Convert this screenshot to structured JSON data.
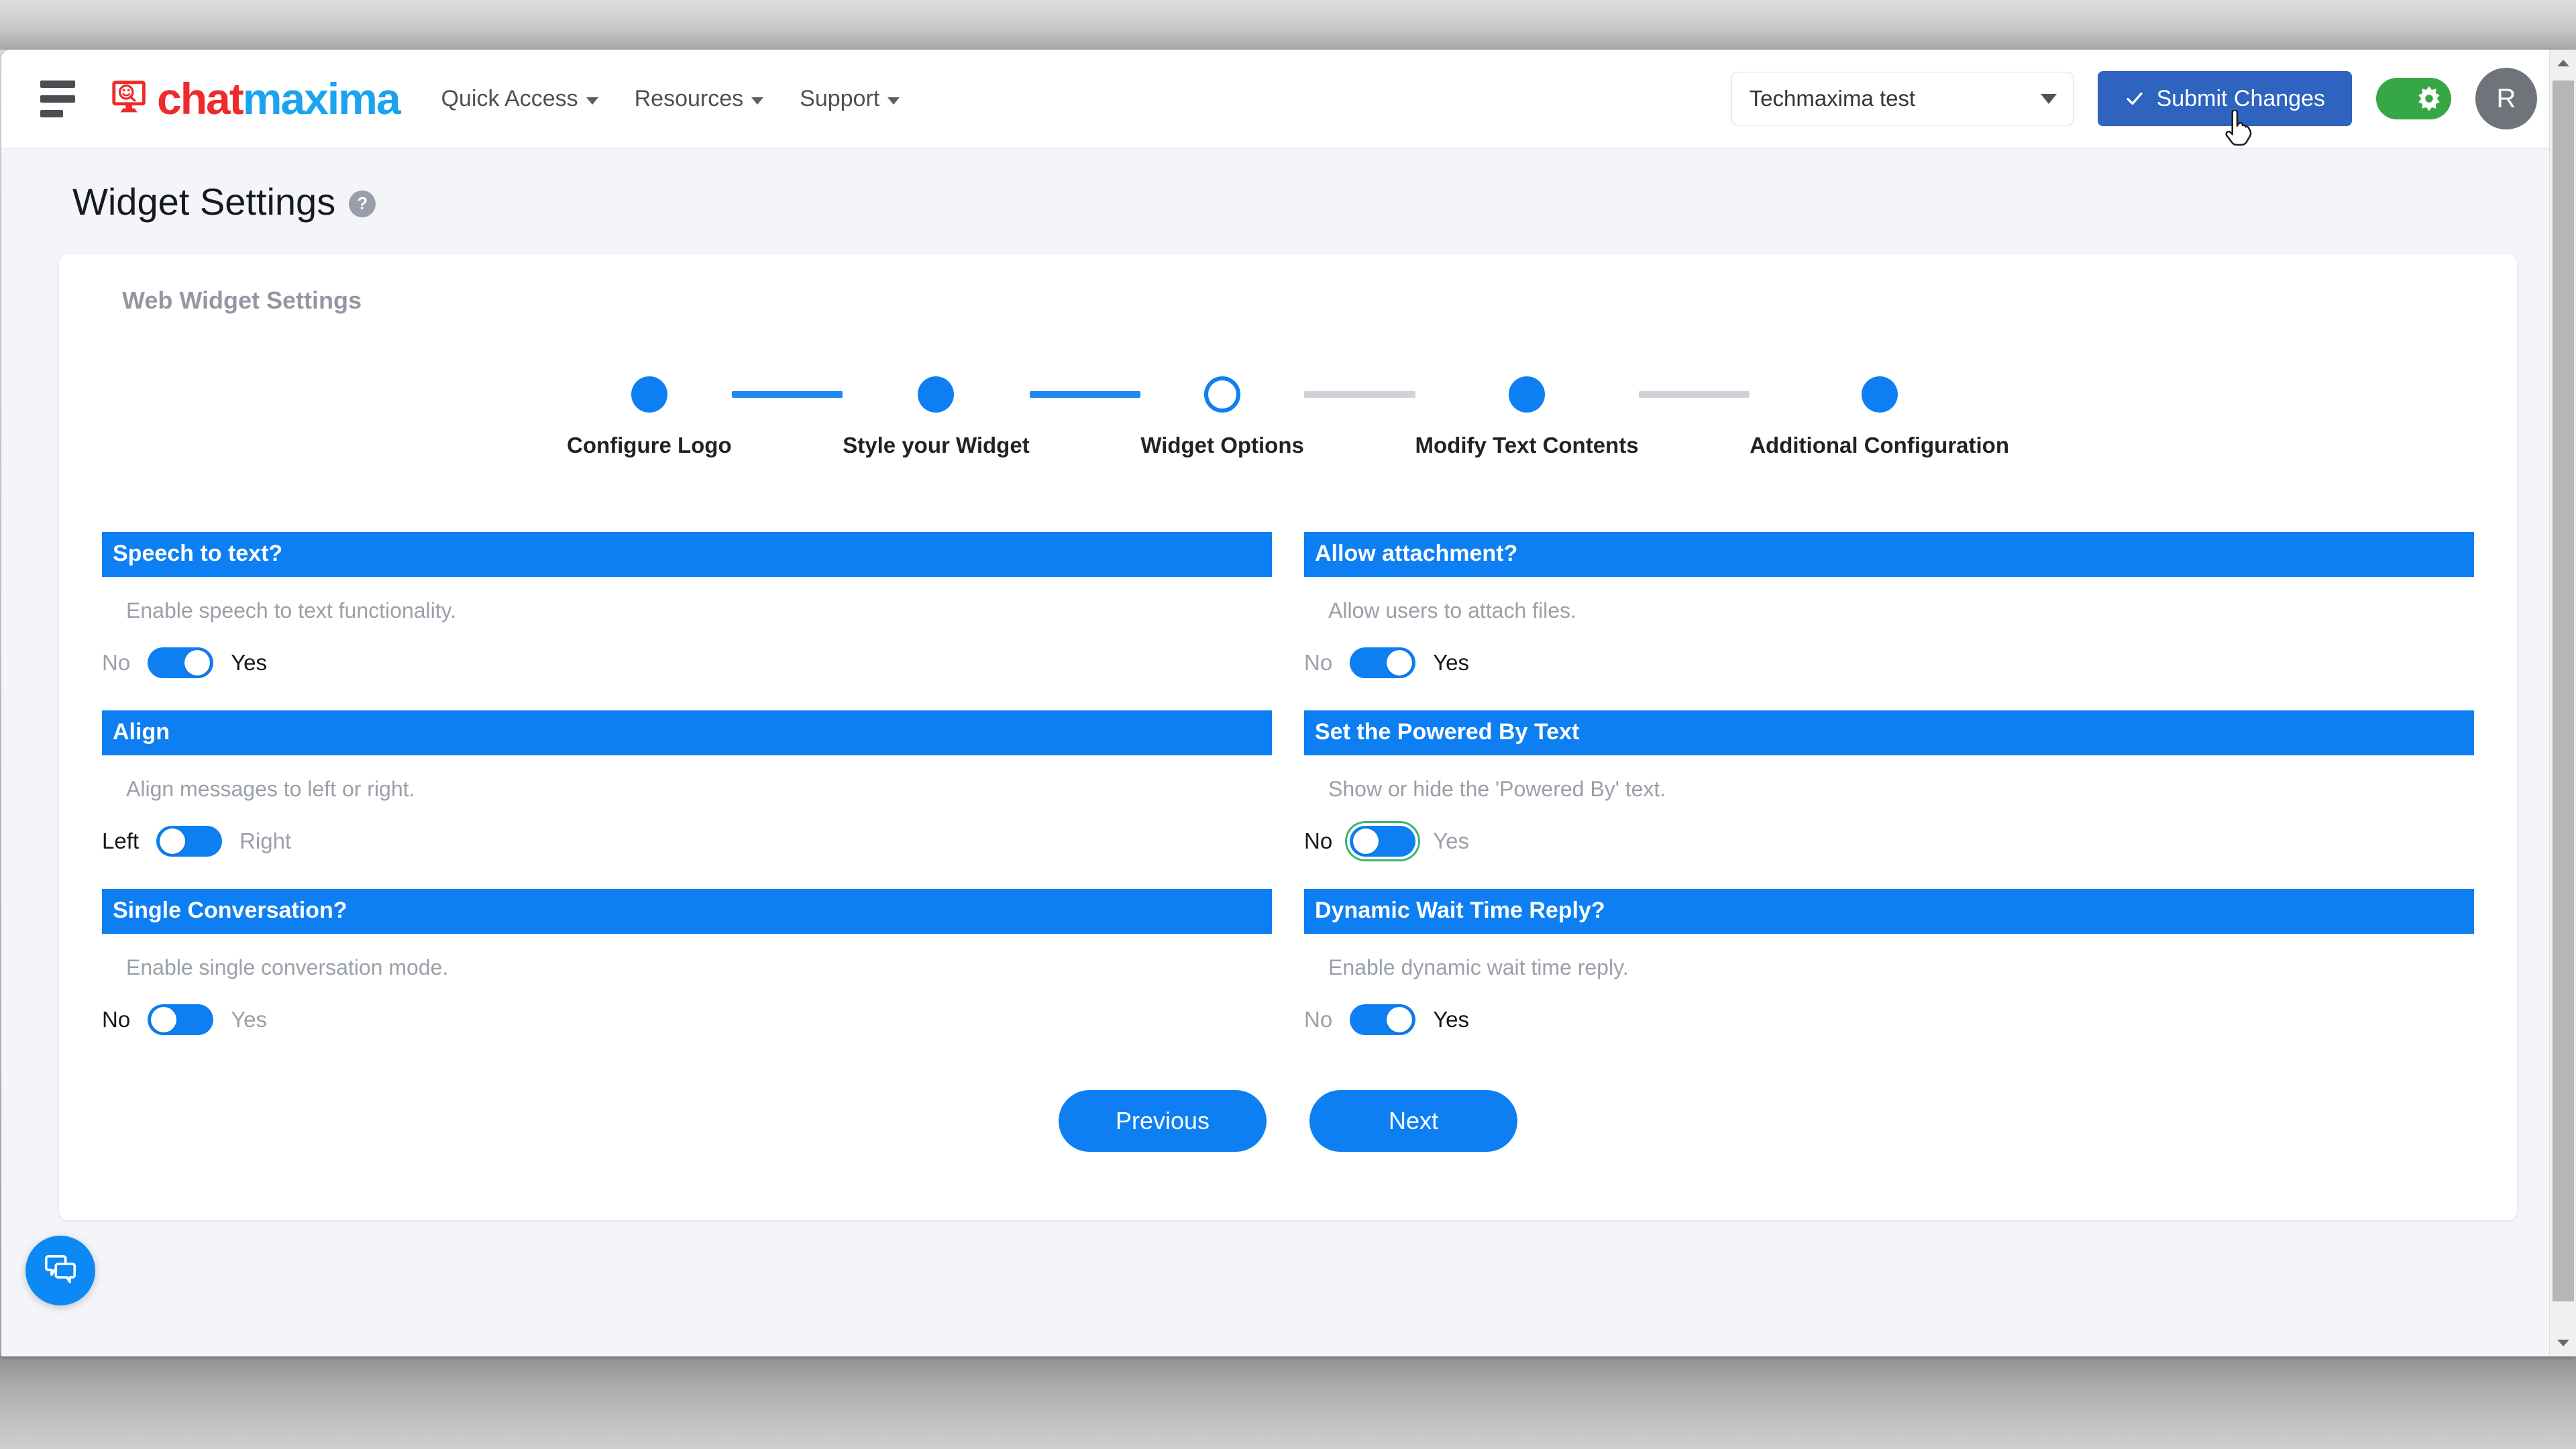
{
  "header": {
    "hamburger_name": "menu-toggle",
    "brand": {
      "word_red": "chat",
      "word_blue": "maxima"
    },
    "nav": [
      {
        "label": "Quick Access"
      },
      {
        "label": "Resources"
      },
      {
        "label": "Support"
      }
    ],
    "workspace": {
      "value": "Techmaxima test"
    },
    "submit_button": {
      "label": "Submit Changes"
    },
    "avatar": {
      "initial": "R"
    }
  },
  "page": {
    "title": "Widget Settings",
    "help_badge": "?",
    "card_subtitle": "Web Widget Settings"
  },
  "stepper": {
    "steps": [
      {
        "label": "Configure Logo",
        "state": "done"
      },
      {
        "label": "Style your Widget",
        "state": "done"
      },
      {
        "label": "Widget Options",
        "state": "active"
      },
      {
        "label": "Modify Text Contents",
        "state": "done"
      },
      {
        "label": "Additional Configuration",
        "state": "done"
      }
    ],
    "connectors": [
      "done",
      "done",
      "pending",
      "pending"
    ]
  },
  "settings": [
    {
      "title": "Speech to text?",
      "description": "Enable speech to text functionality.",
      "off_label": "No",
      "on_label": "Yes",
      "state": "on",
      "focused": false
    },
    {
      "title": "Allow attachment?",
      "description": "Allow users to attach files.",
      "off_label": "No",
      "on_label": "Yes",
      "state": "on",
      "focused": false
    },
    {
      "title": "Align",
      "description": "Align messages to left or right.",
      "off_label": "Left",
      "on_label": "Right",
      "state": "off",
      "focused": false
    },
    {
      "title": "Set the Powered By Text",
      "description": "Show or hide the 'Powered By' text.",
      "off_label": "No",
      "on_label": "Yes",
      "state": "off",
      "focused": true
    },
    {
      "title": "Single Conversation?",
      "description": "Enable single conversation mode.",
      "off_label": "No",
      "on_label": "Yes",
      "state": "off",
      "focused": false
    },
    {
      "title": "Dynamic Wait Time Reply?",
      "description": "Enable dynamic wait time reply.",
      "off_label": "No",
      "on_label": "Yes",
      "state": "on",
      "focused": false
    }
  ],
  "wizard": {
    "previous_label": "Previous",
    "next_label": "Next"
  },
  "colors": {
    "accent_blue": "#0d7ff2",
    "submit_blue": "#2e63c0",
    "toggle_green": "#35a845",
    "focus_green": "#3cb371",
    "brand_red": "#ee2b2b",
    "brand_blue": "#1aa3ef",
    "page_bg": "#f4f5f9"
  }
}
